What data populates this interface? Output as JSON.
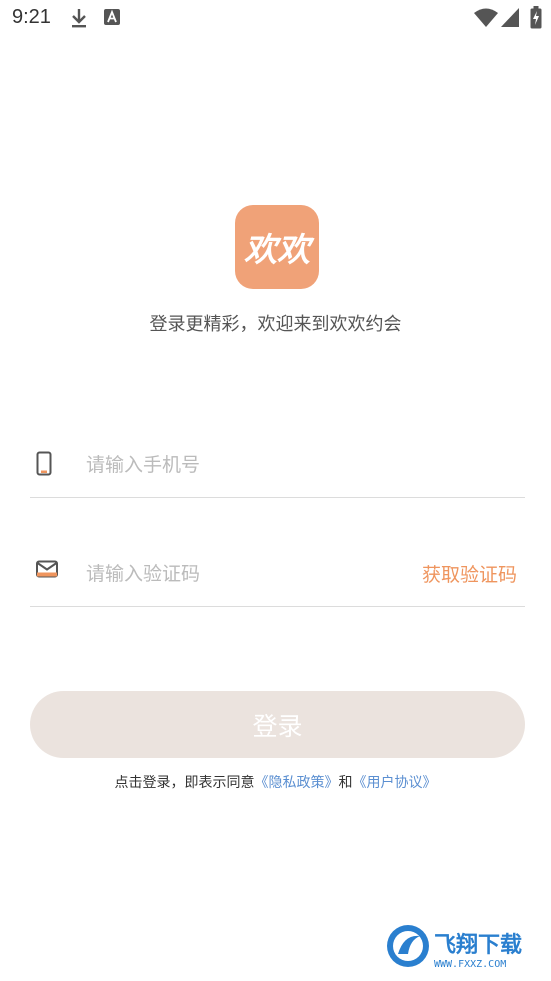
{
  "status_bar": {
    "time": "9:21",
    "icons": [
      "download-icon",
      "keyboard-a-icon",
      "wifi-icon",
      "signal-icon",
      "battery-charging-icon"
    ]
  },
  "app": {
    "logo_text": "欢欢",
    "logo_color": "#f0a278",
    "tagline": "登录更精彩，欢迎来到欢欢约会"
  },
  "form": {
    "phone": {
      "placeholder": "请输入手机号",
      "value": "",
      "icon": "phone-icon"
    },
    "code": {
      "placeholder": "请输入验证码",
      "value": "",
      "icon": "mail-icon",
      "get_code_label": "获取验证码"
    },
    "accent_color": "#ef955e"
  },
  "login_button": {
    "label": "登录",
    "background": "#ebe3de"
  },
  "agreement": {
    "prefix": "点击登录，即表示同意",
    "privacy_link": "《隐私政策》",
    "conjunction": "和",
    "user_link": "《用户协议》",
    "link_color": "#5b8fd1"
  },
  "watermark": {
    "text": "飞翔下载",
    "url_text": "WWW.FXXZ.COM"
  }
}
